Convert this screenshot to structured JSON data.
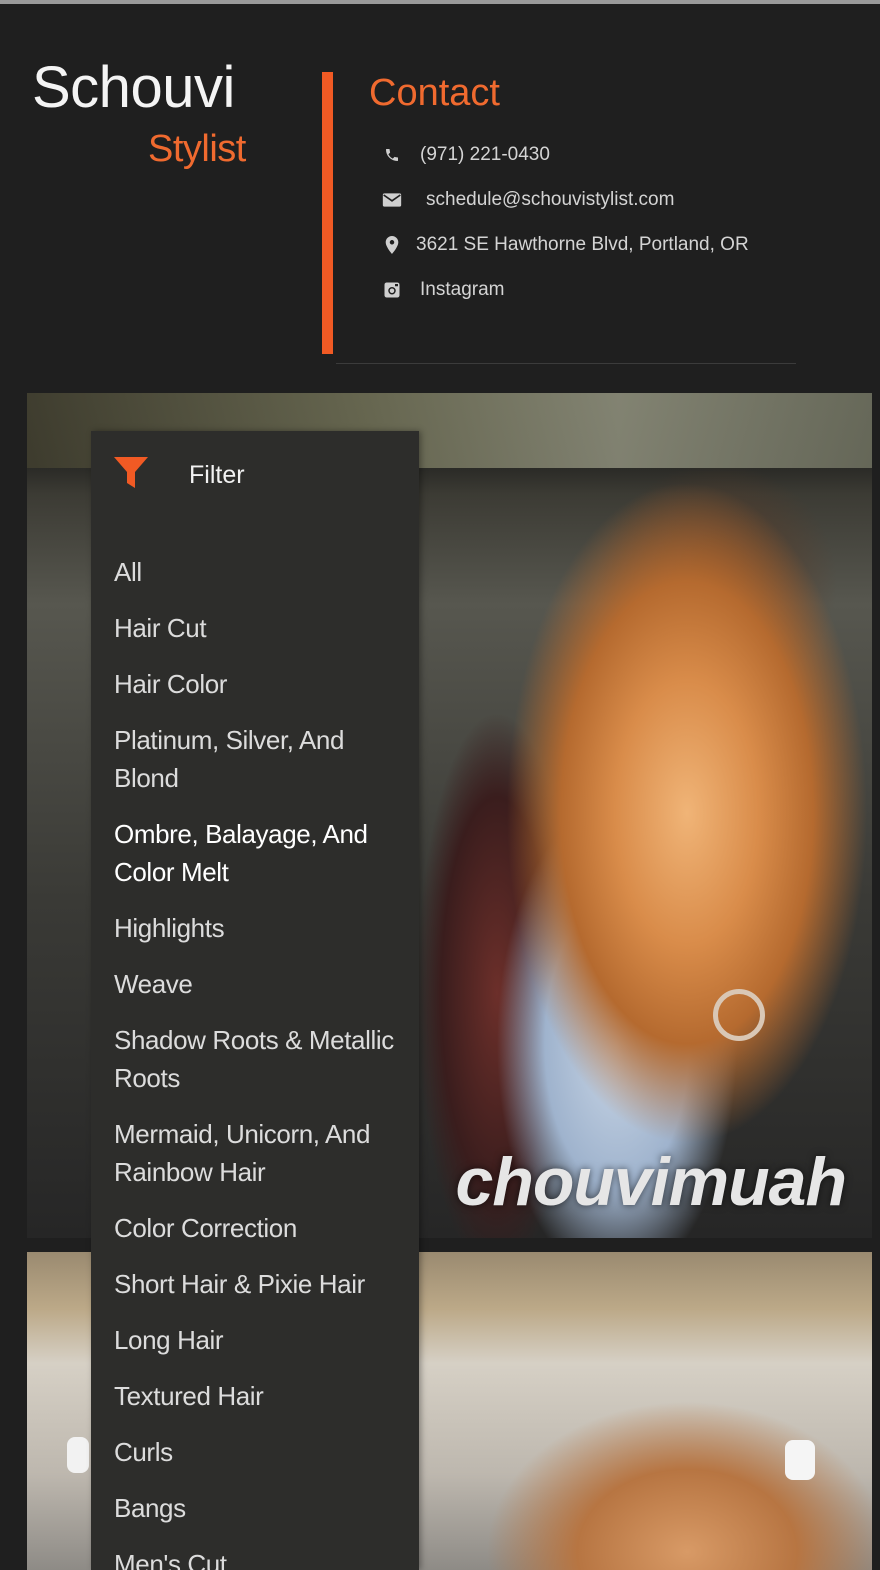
{
  "brand": {
    "name": "Schouvi",
    "subtitle": "Stylist"
  },
  "contact": {
    "title": "Contact",
    "phone": "(971) 221-0430",
    "email": "schedule@schouvistylist.com",
    "address": "3621 SE Hawthorne Blvd, Portland, OR",
    "instagram": "Instagram"
  },
  "icons": {
    "phone": "phone-icon",
    "email": "envelope-icon",
    "address": "map-marker-icon",
    "instagram": "instagram-icon",
    "filter": "funnel-icon"
  },
  "colors": {
    "accent": "#f15a24",
    "background": "#1f1f1f",
    "panel": "#2d2d2b"
  },
  "filter": {
    "title": "Filter",
    "items": [
      "All",
      "Hair Cut",
      "Hair Color",
      "Platinum, Silver, And Blond",
      "Ombre, Balayage, And Color Melt",
      "Highlights",
      "Weave",
      "Shadow Roots & Metallic Roots",
      "Mermaid, Unicorn, And Rainbow Hair",
      "Color Correction",
      "Short Hair & Pixie Hair",
      "Long Hair",
      "Textured Hair",
      "Curls",
      "Bangs",
      "Men's Cut"
    ],
    "active": "Ombre, Balayage, And Color Melt"
  },
  "gallery": {
    "watermark": "chouvimuah"
  }
}
